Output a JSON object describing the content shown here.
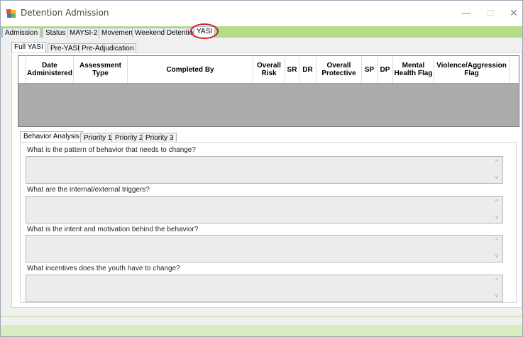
{
  "window": {
    "title": "Detention Admission",
    "minimize_glyph": "—",
    "maximize_glyph": "☐",
    "close_glyph": "✕"
  },
  "main_tabs": [
    {
      "label": "Admission"
    },
    {
      "label": "Status"
    },
    {
      "label": "MAYSI-2"
    },
    {
      "label": "Movement"
    },
    {
      "label": "Weekend Detention"
    },
    {
      "label": "YASI"
    }
  ],
  "yasi_tabs": [
    {
      "label": "Full YASI"
    },
    {
      "label": "Pre-YASI"
    },
    {
      "label": "Pre-Adjudication"
    }
  ],
  "grid": {
    "columns": [
      {
        "label": "Date Administered"
      },
      {
        "label": "Assessment Type"
      },
      {
        "label": "Completed By"
      },
      {
        "label": "Overall Risk"
      },
      {
        "label": "SR"
      },
      {
        "label": "DR"
      },
      {
        "label": "Overall Protective"
      },
      {
        "label": "SP"
      },
      {
        "label": "DP"
      },
      {
        "label": "Mental Health Flag"
      },
      {
        "label": "Violence/Aggression Flag"
      }
    ]
  },
  "analysis_tabs": [
    {
      "label": "Behavior Analysis"
    },
    {
      "label": "Priority 1"
    },
    {
      "label": "Priority 2"
    },
    {
      "label": "Priority 3"
    }
  ],
  "questions": [
    {
      "label": "What is the pattern of behavior that needs to change?",
      "value": ""
    },
    {
      "label": "What are the internal/external triggers?",
      "value": ""
    },
    {
      "label": "What is the intent and motivation behind the behavior?",
      "value": ""
    },
    {
      "label": "What incentives does the youth have to change?",
      "value": ""
    }
  ],
  "icons": {
    "scroll_up": "^",
    "scroll_down": "v"
  },
  "colors": {
    "tab_strip_green": "#b5dd89",
    "highlight_circle": "#d11f1f",
    "grid_empty": "#ababab"
  }
}
